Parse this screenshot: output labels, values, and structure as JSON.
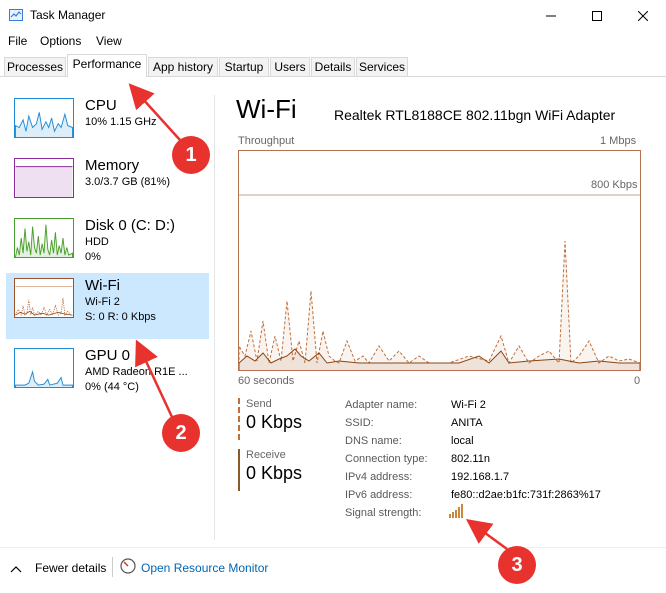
{
  "window": {
    "title": "Task Manager"
  },
  "menu": [
    "File",
    "Options",
    "View"
  ],
  "tabs": [
    "Processes",
    "Performance",
    "App history",
    "Startup",
    "Users",
    "Details",
    "Services"
  ],
  "sidebar": {
    "items": [
      {
        "title": "CPU",
        "sub1": "10%  1.15 GHz",
        "sub2": ""
      },
      {
        "title": "Memory",
        "sub1": "3.0/3.7 GB (81%)",
        "sub2": ""
      },
      {
        "title": "Disk 0 (C: D:)",
        "sub1": "HDD",
        "sub2": "0%"
      },
      {
        "title": "Wi-Fi",
        "sub1": "Wi-Fi 2",
        "sub2": "S: 0  R: 0 Kbps"
      },
      {
        "title": "GPU 0",
        "sub1": "AMD Radeon R1E ...",
        "sub2": "0%  (44 °C)"
      }
    ]
  },
  "main": {
    "title": "Wi-Fi",
    "adapter": "Realtek RTL8188CE 802.11bgn WiFi Adapter",
    "graph": {
      "label_left": "Throughput",
      "label_right": "1 Mbps",
      "threshold_label": "800 Kbps",
      "x_left": "60 seconds",
      "x_right": "0"
    },
    "send": {
      "label": "Send",
      "value": "0 Kbps"
    },
    "receive": {
      "label": "Receive",
      "value": "0 Kbps"
    },
    "properties": [
      {
        "label": "Adapter name:",
        "value": "Wi-Fi 2"
      },
      {
        "label": "SSID:",
        "value": "ANITA"
      },
      {
        "label": "DNS name:",
        "value": "local"
      },
      {
        "label": "Connection type:",
        "value": "802.11n"
      },
      {
        "label": "IPv4 address:",
        "value": "192.168.1.7"
      },
      {
        "label": "IPv6 address:",
        "value": "fe80::d2ae:b1fc:731f:2863%17"
      },
      {
        "label": "Signal strength:",
        "value": ""
      }
    ]
  },
  "footer": {
    "fewer_details": "Fewer details",
    "resource_monitor": "Open Resource Monitor"
  },
  "annotations": [
    "1",
    "2",
    "3"
  ],
  "colors": {
    "accent": "#cce8ff",
    "wifi": "#c06f3a",
    "annotation": "#e8322e"
  }
}
